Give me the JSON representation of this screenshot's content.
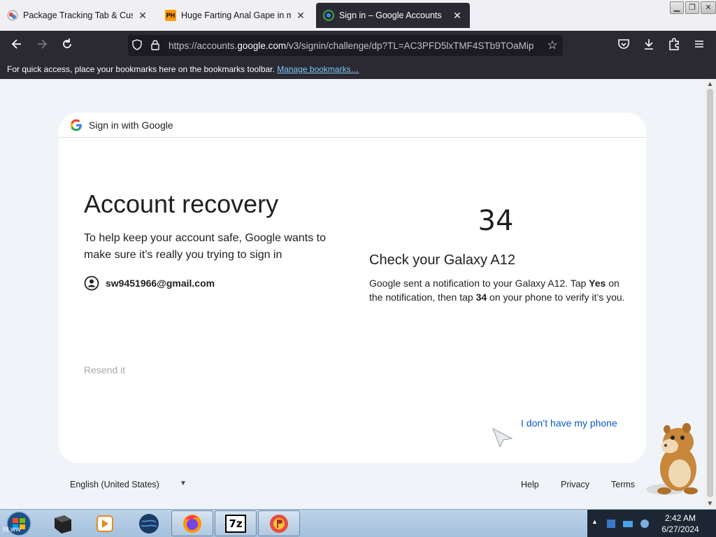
{
  "browser": {
    "tabs": [
      {
        "title": "Package Tracking Tab & Custom",
        "active": false
      },
      {
        "title": "Huge Farting Anal Gape in my",
        "favicon_text": "PH",
        "active": false
      },
      {
        "title": "Sign in – Google Accounts",
        "active": true
      }
    ],
    "url_prefix": "https://accounts.",
    "url_domain": "google.com",
    "url_suffix": "/v3/signin/challenge/dp?TL=AC3PFD5lxTMF4STb9TOaMip",
    "bookmarks_message": "For quick access, place your bookmarks here on the bookmarks toolbar.",
    "bookmarks_link": "Manage bookmarks…"
  },
  "page": {
    "header_label": "Sign in with Google",
    "title": "Account recovery",
    "description": "To help keep your account safe, Google wants to make sure it’s really you trying to sign in",
    "email": "sw9451966@gmail.com",
    "resend": "Resend it",
    "code": "34",
    "check_title": "Check your Galaxy A12",
    "instructions": {
      "part1": "Google sent a notification to your Galaxy A12. Tap ",
      "bold1": "Yes",
      "part2": " on the notification, then tap ",
      "bold2": "34",
      "part3": " on your phone to verify it’s you."
    },
    "no_phone_link": "I don’t have my phone"
  },
  "footer": {
    "language": "English (United States)",
    "help": "Help",
    "privacy": "Privacy",
    "terms": "Terms"
  },
  "taskbar": {
    "time": "2:42 AM",
    "date": "6/27/2024",
    "hover_text": "ht  ww",
    "seven_zip": "7z"
  },
  "colors": {
    "link_blue": "#0b57d0",
    "toolbar_dark": "#2b2a33",
    "page_bg": "#f0f4f9"
  }
}
